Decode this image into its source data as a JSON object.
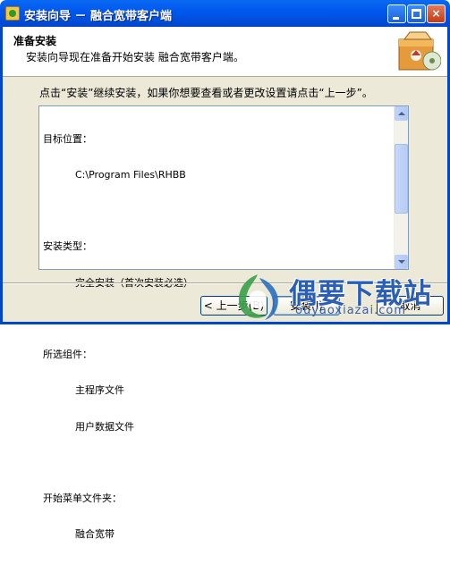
{
  "window": {
    "title": "安装向导 － 融合宽带客户端",
    "controls": {
      "minimize": "minimize",
      "maximize": "maximize",
      "close": "×"
    }
  },
  "header": {
    "title": "准备安装",
    "subtitle": "安装向导现在准备开始安装 融合宽带客户端。"
  },
  "intro_text": "点击“安装”继续安装，如果你想要查看或者更改设置请点击“上一步”。",
  "summary": {
    "target_label": "目标位置：",
    "target_value": "C:\\Program Files\\RHBB",
    "type_label": "安装类型：",
    "type_value": "完全安装（首次安装必选）",
    "components_label": "所选组件：",
    "components": [
      "主程序文件",
      "用户数据文件"
    ],
    "start_menu_label": "开始菜单文件夹：",
    "start_menu_value": "融合宽带"
  },
  "buttons": {
    "back": "< 上一步(B)",
    "install": "安装(I)",
    "cancel": "取消"
  },
  "watermark": {
    "brand": "偶要下载站",
    "url": "ouyaoxiazai.com"
  },
  "colors": {
    "titlebar": "#0058ee",
    "dialog_bg": "#ece9d8",
    "watermark": "#2a5fb5"
  }
}
